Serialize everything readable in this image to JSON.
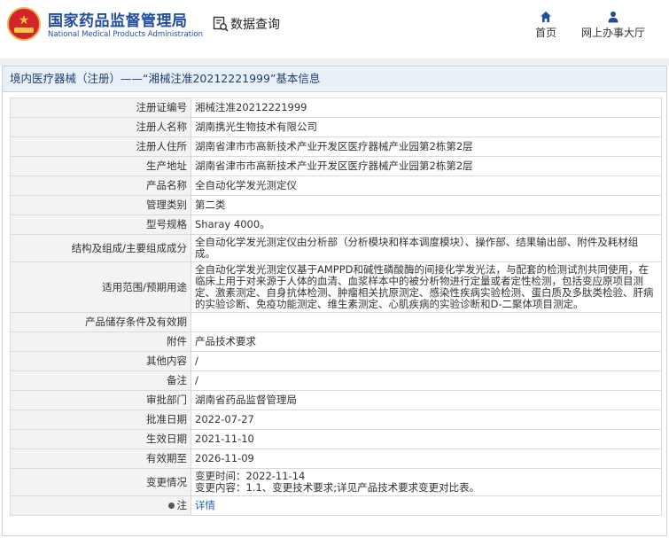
{
  "header": {
    "title_cn": "国家药品监督管理局",
    "title_en": "National Medical Products Administration",
    "db_title": "数据查询",
    "nav": [
      {
        "label": "首页",
        "icon": "home-icon"
      },
      {
        "label": "网上办事大厅",
        "icon": "user-icon"
      }
    ]
  },
  "panel": {
    "title": "境内医疗器械（注册）——“湘械注准20212221999”基本信息"
  },
  "rows": [
    {
      "k": "注册证编号",
      "v": "湘械注准20212221999"
    },
    {
      "k": "注册人名称",
      "v": "湖南携光生物技术有限公司"
    },
    {
      "k": "注册人住所",
      "v": "湖南省津市市高新技术产业开发区医疗器械产业园第2栋第2层"
    },
    {
      "k": "生产地址",
      "v": "湖南省津市市高新技术产业开发区医疗器械产业园第2栋第2层"
    },
    {
      "k": "产品名称",
      "v": "全自动化学发光测定仪"
    },
    {
      "k": "管理类别",
      "v": "第二类"
    },
    {
      "k": "型号规格",
      "v": "Sharay 4000。"
    },
    {
      "k": "结构及组成/主要组成成分",
      "v": "全自动化学发光测定仪由分析部（分析模块和样本调度模块）、操作部、结果输出部、附件及耗材组成。"
    },
    {
      "k": "适用范围/预期用途",
      "v": "全自动化学发光测定仪基于AMPPD和碱性磷酸酶的间接化学发光法，与配套的检测试剂共同使用，在临床上用于对来源于人体的血清、血浆样本中的被分析物进行定量或者定性检测，包括变应原项目测定、激素测定、自身抗体检测、肿瘤相关抗原测定、感染性疾病实验检测、蛋白质及多肽类检验、肝病的实验诊断、免疫功能测定、维生素测定、心肌疾病的实验诊断和D-二聚体项目测定。"
    },
    {
      "k": "产品储存条件及有效期",
      "v": ""
    },
    {
      "k": "附件",
      "v": "产品技术要求"
    },
    {
      "k": "其他内容",
      "v": "/"
    },
    {
      "k": "备注",
      "v": "/"
    },
    {
      "k": "审批部门",
      "v": "湖南省药品监督管理局"
    },
    {
      "k": "批准日期",
      "v": "2022-07-27"
    },
    {
      "k": "生效日期",
      "v": "2021-11-10"
    },
    {
      "k": "有效期至",
      "v": "2026-11-09"
    }
  ],
  "change": {
    "k": "变更情况",
    "line1": "变更时间：2022-11-14",
    "line2": "变更内容：1.1、变更技术要求;详见产品技术要求变更对比表。"
  },
  "note": {
    "k": "注",
    "link": "详情"
  }
}
